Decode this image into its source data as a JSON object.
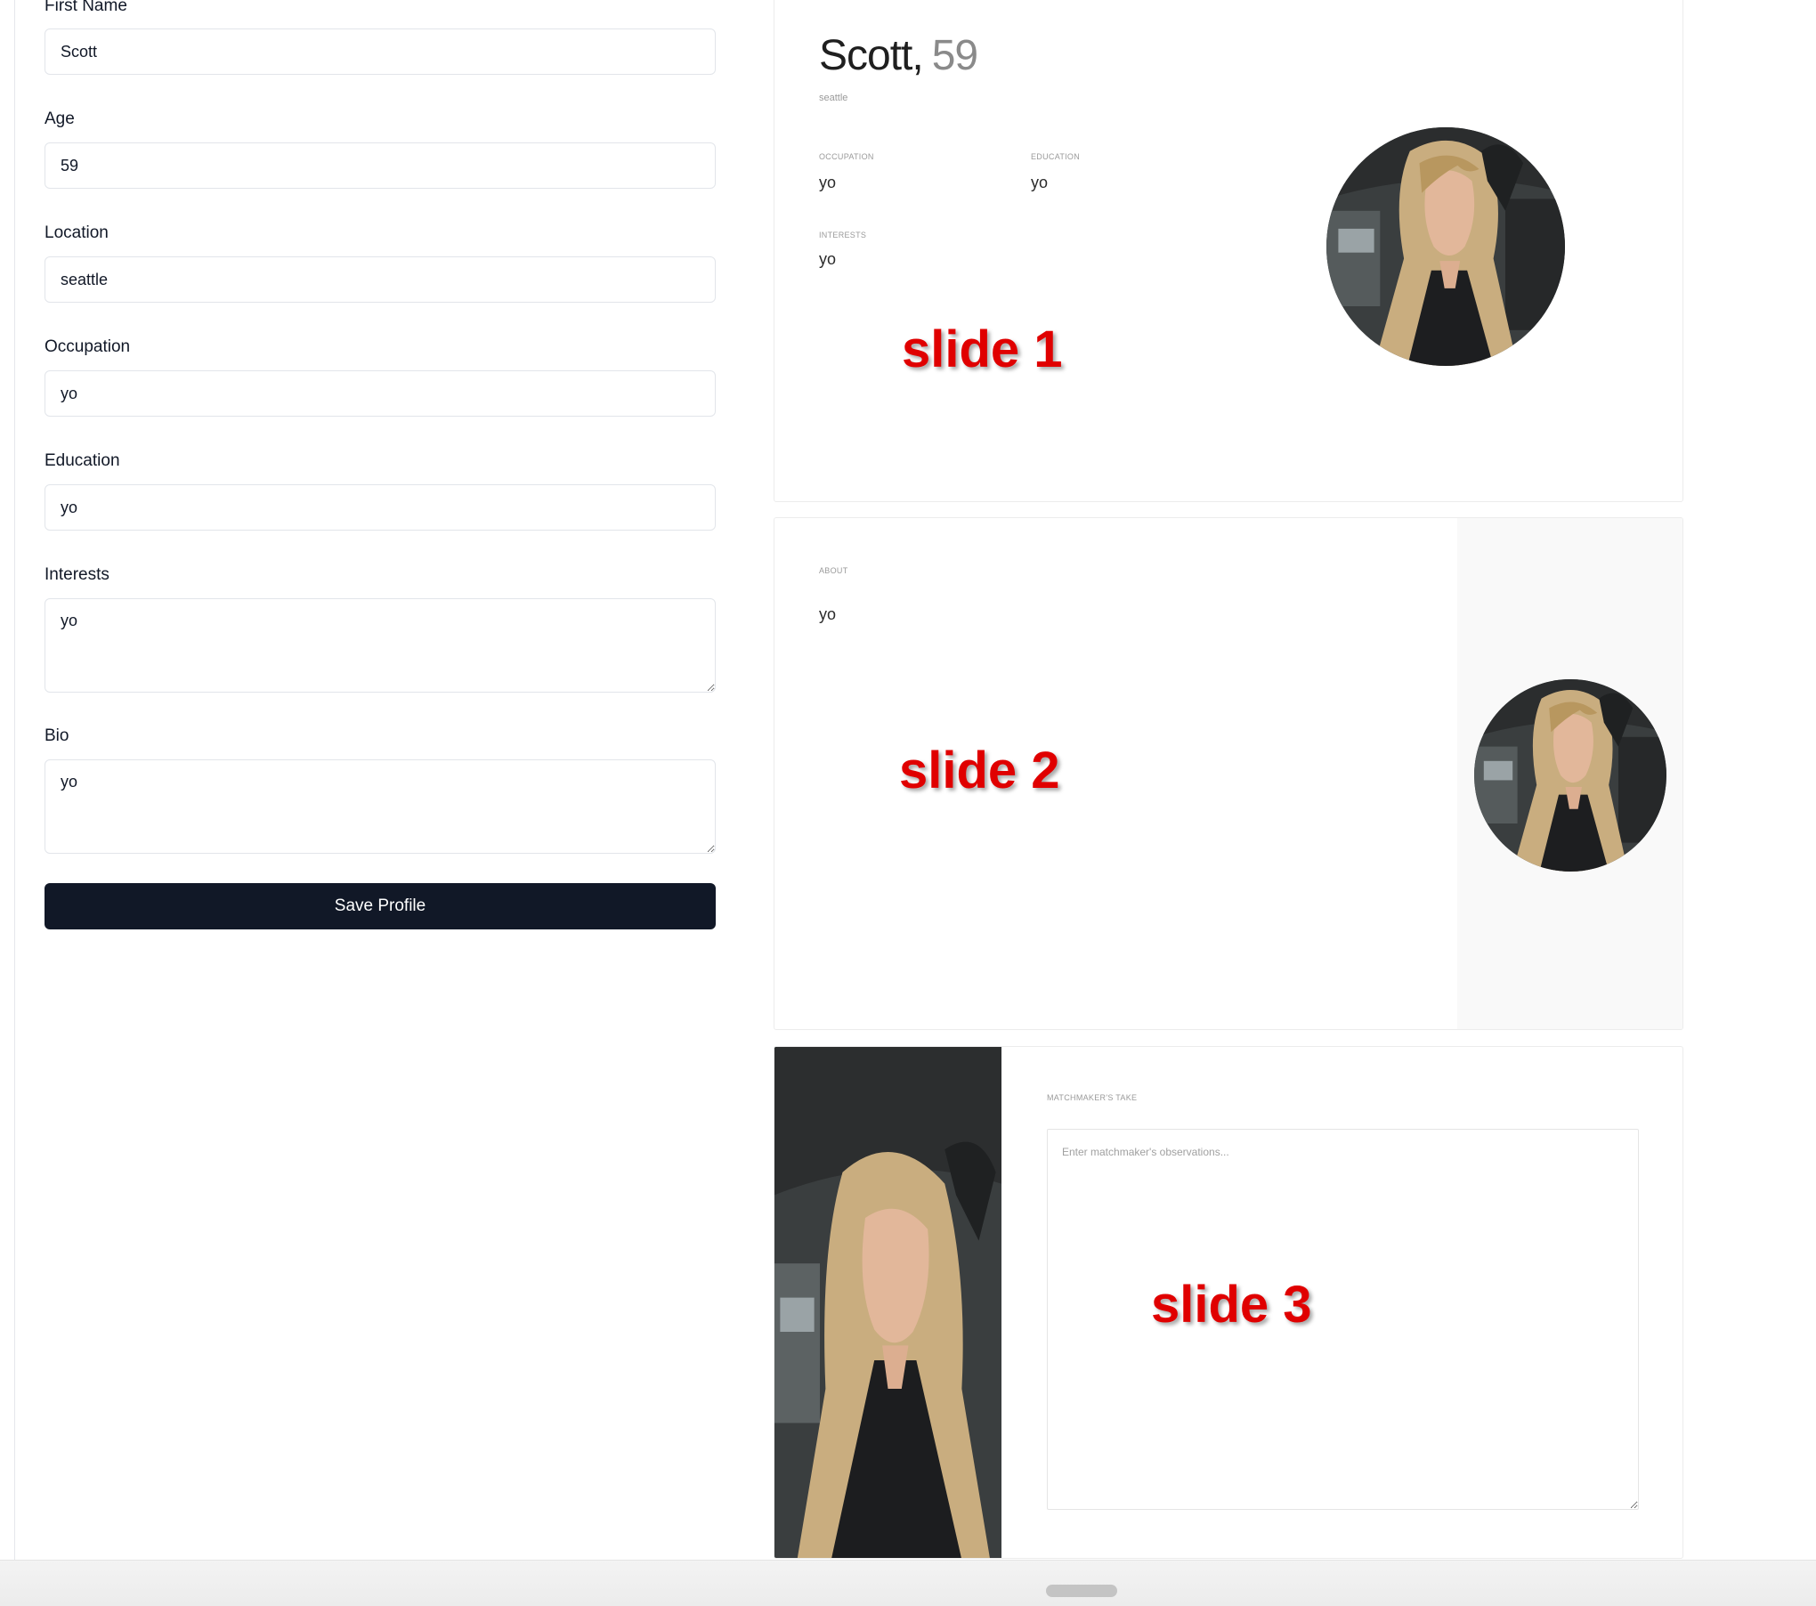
{
  "form": {
    "first_name": {
      "label": "First Name",
      "value": "Scott"
    },
    "age": {
      "label": "Age",
      "value": "59"
    },
    "location": {
      "label": "Location",
      "value": "seattle"
    },
    "occupation": {
      "label": "Occupation",
      "value": "yo"
    },
    "education": {
      "label": "Education",
      "value": "yo"
    },
    "interests": {
      "label": "Interests",
      "value": "yo"
    },
    "bio": {
      "label": "Bio",
      "value": "yo"
    },
    "save_label": "Save Profile"
  },
  "slide1": {
    "name": "Scott",
    "comma": ",",
    "age": "59",
    "location": "seattle",
    "occupation_label": "OCCUPATION",
    "occupation": "yo",
    "education_label": "EDUCATION",
    "education": "yo",
    "interests_label": "INTERESTS",
    "interests": "yo",
    "tag": "slide 1"
  },
  "slide2": {
    "about_label": "ABOUT",
    "about": "yo",
    "tag": "slide 2"
  },
  "slide3": {
    "take_label": "MATCHMAKER'S TAKE",
    "placeholder": "Enter matchmaker's observations...",
    "tag": "slide 3"
  },
  "colors": {
    "button_bg": "#111827",
    "annotation_red": "#e00000"
  }
}
